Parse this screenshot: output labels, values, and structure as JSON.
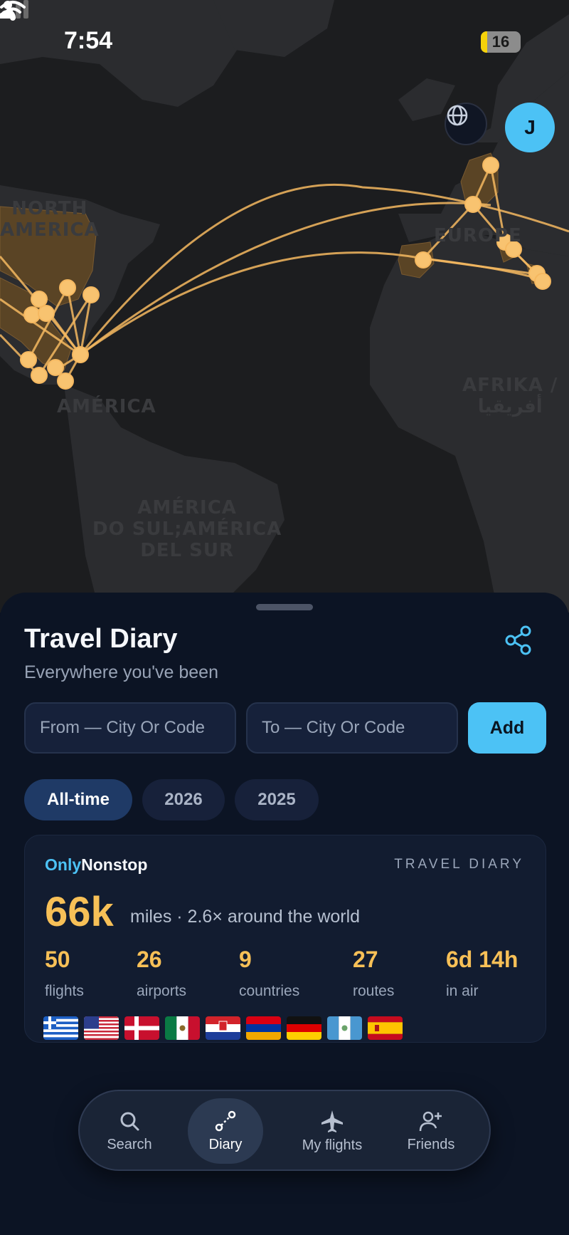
{
  "status_bar": {
    "time": "7:54",
    "battery": "16",
    "battery_level": 0.16
  },
  "map": {
    "labels": [
      "NORTH\nAMERICA",
      "AMÉRICA",
      "AMÉRICA\nDO SUL;AMÉRICA\nDEL SUR",
      "EUROPE",
      "AFRIKA /\nأفريقيا"
    ],
    "route_color": "#f5b860",
    "avatar_initial": "J"
  },
  "diary": {
    "title": "Travel Diary",
    "subtitle": "Everywhere you've been",
    "from_placeholder": "From — City Or Code",
    "to_placeholder": "To — City Or Code",
    "add_label": "Add",
    "filters": [
      "All-time",
      "2026",
      "2025"
    ],
    "active_filter": "All-time"
  },
  "card": {
    "brand_part1": "Only",
    "brand_part2": "Nonstop",
    "tag": "TRAVEL DIARY",
    "miles_value": "66k",
    "miles_text": "miles · 2.6× around the world",
    "stats": [
      {
        "value": "50",
        "label": "flights"
      },
      {
        "value": "26",
        "label": "airports"
      },
      {
        "value": "9",
        "label": "countries"
      },
      {
        "value": "27",
        "label": "routes"
      },
      {
        "value": "6d 14h",
        "label": "in air"
      }
    ],
    "flags": [
      "greece-flag",
      "usa-flag",
      "denmark-flag",
      "mexico-flag",
      "croatia-flag",
      "armenia-flag",
      "germany-flag",
      "guatemala-flag",
      "spain-flag"
    ]
  },
  "tabbar": {
    "tabs": [
      {
        "label": "Search",
        "icon": "search-icon"
      },
      {
        "label": "Diary",
        "icon": "route-icon"
      },
      {
        "label": "My flights",
        "icon": "plane-icon"
      },
      {
        "label": "Friends",
        "icon": "add-friend-icon"
      }
    ],
    "active": "Diary"
  },
  "colors": {
    "accent_blue": "#4cc2f5",
    "accent_gold": "#f7c057",
    "sheet_bg": "#0c1424"
  }
}
